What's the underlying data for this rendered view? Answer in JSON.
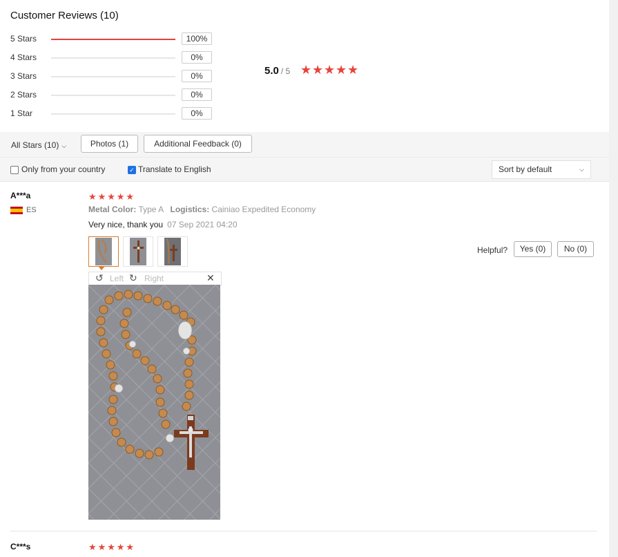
{
  "header": {
    "title": "Customer Reviews (10)",
    "ratings": [
      {
        "label": "5 Stars",
        "percent": "100%",
        "fill": 1.0
      },
      {
        "label": "4 Stars",
        "percent": "0%",
        "fill": 0.0
      },
      {
        "label": "3 Stars",
        "percent": "0%",
        "fill": 0.0
      },
      {
        "label": "2 Stars",
        "percent": "0%",
        "fill": 0.0
      },
      {
        "label": "1 Star",
        "percent": "0%",
        "fill": 0.0
      }
    ],
    "average": "5.0",
    "out_of": "/ 5",
    "stars": 5
  },
  "filters": {
    "all_stars": "All Stars (10)",
    "photos": "Photos (1)",
    "additional_feedback": "Additional Feedback (0)"
  },
  "options": {
    "only_country": "Only from your country",
    "only_country_checked": false,
    "translate": "Translate to English",
    "translate_checked": true,
    "sort": "Sort by default"
  },
  "reviews": [
    {
      "name": "A***a",
      "country": "ES",
      "stars": 5,
      "metal_label": "Metal Color:",
      "metal_value": "Type A",
      "logistics_label": "Logistics:",
      "logistics_value": "Cainiao Expedited Economy",
      "text": "Very nice, thank you",
      "date": "07 Sep 2021 04:20",
      "helpful_label": "Helpful?",
      "yes": "Yes (0)",
      "no": "No (0)",
      "viewer": {
        "left": "Left",
        "right": "Right"
      }
    },
    {
      "name": "C***s",
      "stars": 5
    }
  ],
  "colors": {
    "accent": "#e43f3f",
    "star": "#e6453b",
    "active_thumb": "#d97b28",
    "checkbox": "#1f6fe5"
  }
}
